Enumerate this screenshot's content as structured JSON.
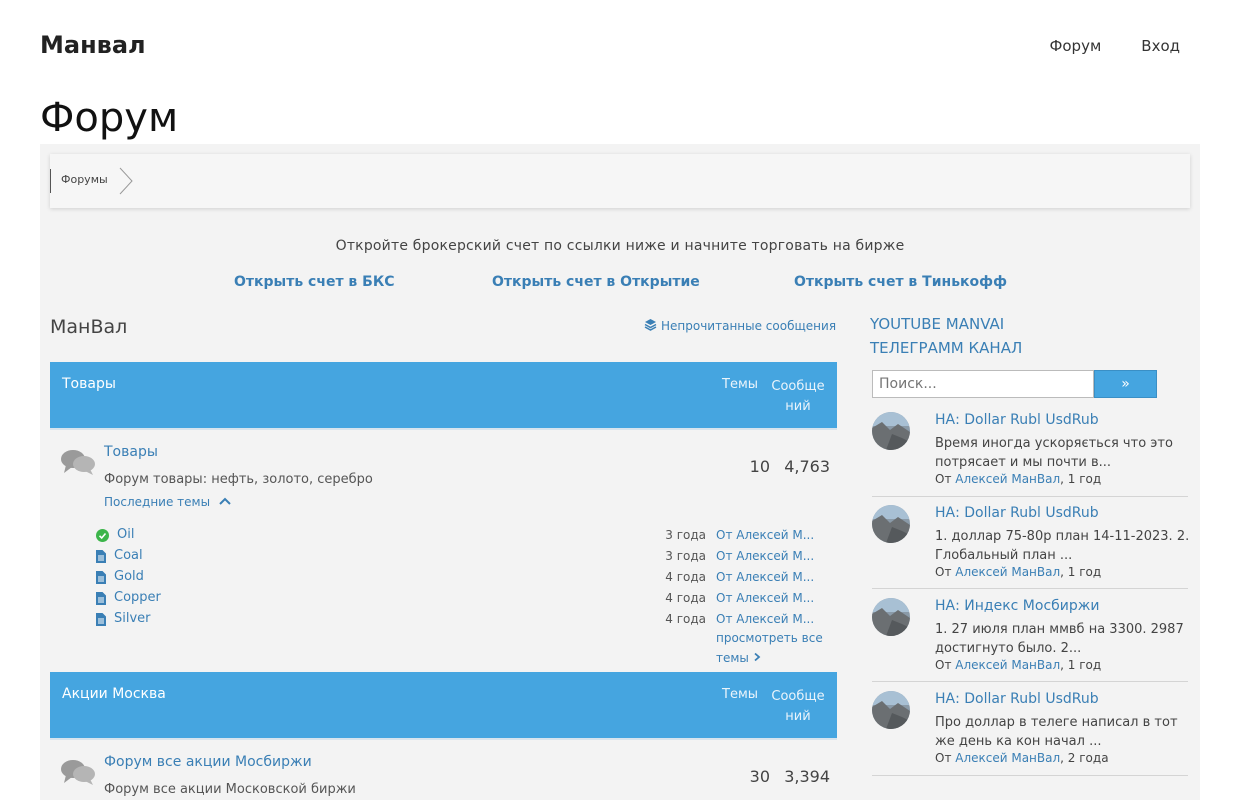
{
  "site": {
    "title": "Манвал",
    "nav": [
      "Форум",
      "Вход"
    ]
  },
  "page": {
    "heading": "Форум"
  },
  "breadcrumb": {
    "label": "Форумы"
  },
  "promo": {
    "text": "Откройте брокерский счет  по ссылки ниже и начните торговать на бирже",
    "links": [
      "Открыть счет в БКС",
      "Открыть счет в Открытие",
      "Открыть счет в Тинькофф"
    ]
  },
  "forum": {
    "title": "МанВал",
    "unread_label": "Непрочитанные сообщения",
    "columns": {
      "topics": "Темы",
      "posts_line1": "Сообще",
      "posts_line2": "ний"
    },
    "categories": [
      {
        "name": "Товары",
        "forum": {
          "name": "Товары",
          "description": "Форум товары: нефть, золото, серебро",
          "topics": "10",
          "posts": "4,763",
          "latest_label": "Последние темы"
        },
        "subtopics": [
          {
            "name": "Oil",
            "icon": "check-circle-icon",
            "time": "3 года",
            "by": "От Алексей М..."
          },
          {
            "name": "Coal",
            "icon": "document-icon",
            "time": "3 года",
            "by": "От Алексей М..."
          },
          {
            "name": "Gold",
            "icon": "document-icon",
            "time": "4 года",
            "by": "От Алексей М..."
          },
          {
            "name": "Copper",
            "icon": "document-icon",
            "time": "4 года",
            "by": "От Алексей М..."
          },
          {
            "name": "Silver",
            "icon": "document-icon",
            "time": "4 года",
            "by": "От Алексей М..."
          }
        ],
        "view_all": "просмотреть все темы"
      },
      {
        "name": "Акции Москва",
        "forum": {
          "name": "Форум все акции Мосбиржи",
          "description": "Форум все акции Московской биржи",
          "topics": "30",
          "posts": "3,394"
        }
      }
    ]
  },
  "sidebar": {
    "links": [
      "YOUTUBE MANVAI",
      "ТЕЛЕГРАММ КАНАЛ"
    ],
    "search_placeholder": "Поиск...",
    "search_button": "»",
    "posts": [
      {
        "title": "НА: Dollar Rubl UsdRub",
        "body": "Время иногда ускоряється что это потрясает и мы почти в...",
        "meta_prefix": "От ",
        "author": "Алексей МанВал",
        "time": ", 1 год"
      },
      {
        "title": "НА: Dollar Rubl UsdRub",
        "body": "1. доллар 75-80р план 14-11-2023. 2. Глобальный план ...",
        "meta_prefix": "От ",
        "author": "Алексей МанВал",
        "time": ", 1 год"
      },
      {
        "title": "НА: Индекс Мосбиржи",
        "body": "1. 27 июля план ммвб на 3300. 2987 достигнуто было. 2...",
        "meta_prefix": "От ",
        "author": "Алексей МанВал",
        "time": ", 1 год"
      },
      {
        "title": "НА: Dollar Rubl UsdRub",
        "body": "Про доллар в телеге написал в тот же день ка кон начал ...",
        "meta_prefix": "От ",
        "author": "Алексей МанВал",
        "time": ", 2 года"
      }
    ]
  },
  "colors": {
    "accent": "#45a5e0",
    "link": "#3a7fb5",
    "check": "#3cb54a"
  }
}
